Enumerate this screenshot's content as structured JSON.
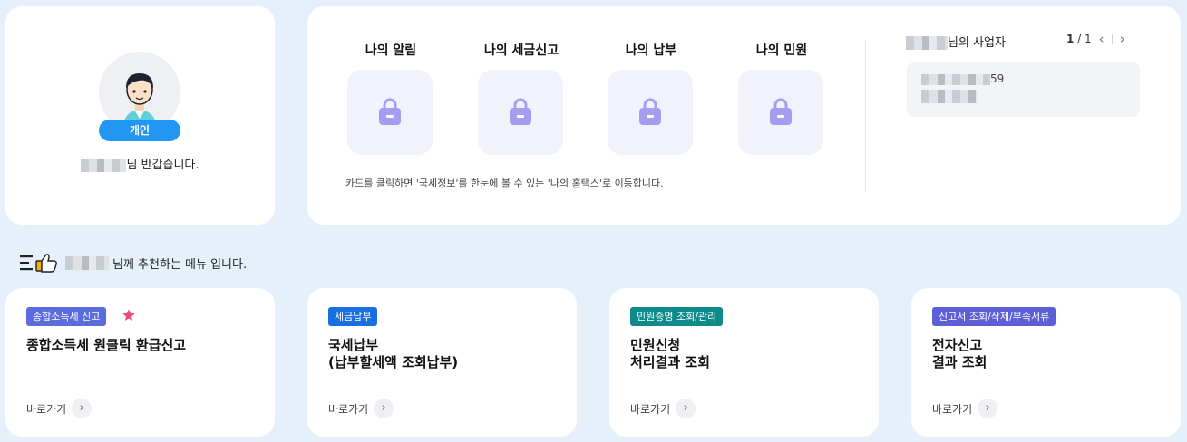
{
  "profile": {
    "type_badge": "개인",
    "greeting_suffix": "님 반갑습니다."
  },
  "shortcuts": [
    {
      "title": "나의 알림",
      "icon": "lock-icon"
    },
    {
      "title": "나의 세금신고",
      "icon": "lock-icon"
    },
    {
      "title": "나의 납부",
      "icon": "lock-icon"
    },
    {
      "title": "나의 민원",
      "icon": "lock-icon"
    }
  ],
  "shortcut_note": "카드를 클릭하면 '국세정보'를 한눈에 볼 수 있는 '나의 홈택스'로 이동합니다.",
  "business": {
    "heading_suffix": "님의 사업자",
    "page_current": "1",
    "page_sep": " / ",
    "page_total": "1",
    "item_suffix": "59"
  },
  "recommend": {
    "title_suffix": "님께 추천하는 메뉴 입니다."
  },
  "menus": [
    {
      "tag": "종합소득세 신고",
      "tag_color": "#5b6cdd",
      "title": "종합소득세 원클릭 환급신고",
      "go": "바로가기",
      "starred": true
    },
    {
      "tag": "세금납부",
      "tag_color": "#1a6fe0",
      "title": "국세납부\n(납부할세액 조회납부)",
      "go": "바로가기"
    },
    {
      "tag": "민원증명 조회/관리",
      "tag_color": "#0f8a8a",
      "title": "민원신청\n처리결과 조회",
      "go": "바로가기"
    },
    {
      "tag": "신고서 조회/삭제/부속서류",
      "tag_color": "#5d5fd6",
      "title": "전자신고\n결과 조회",
      "go": "바로가기"
    }
  ],
  "colors": {
    "accent": "#2196f3",
    "page_bg": "#e6f0fb",
    "lock": "#a79df0",
    "star": "#ef4b73"
  }
}
